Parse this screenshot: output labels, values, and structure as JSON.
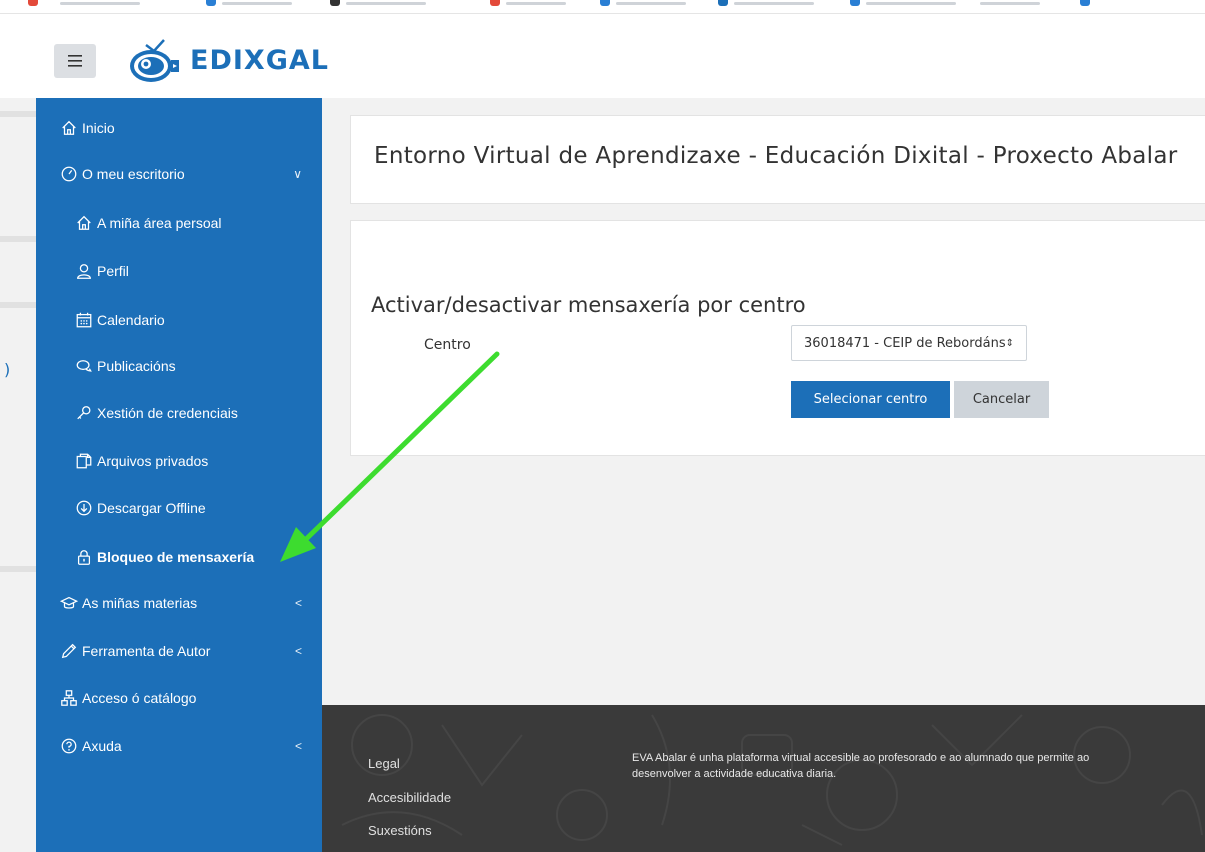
{
  "brand": {
    "name": "EDIXGAL",
    "menu_icon": "hamburger-icon"
  },
  "sidebar": {
    "items": [
      {
        "label": "Inicio",
        "icon": "home-icon"
      },
      {
        "label": "O meu escritorio",
        "icon": "dashboard-gauge-icon",
        "chevron": "∨"
      },
      {
        "label": "A miña área persoal",
        "icon": "home-icon"
      },
      {
        "label": "Perfil",
        "icon": "user-icon"
      },
      {
        "label": "Calendario",
        "icon": "calendar-icon"
      },
      {
        "label": "Publicacións",
        "icon": "chat-bubbles-icon"
      },
      {
        "label": "Xestión de credenciais",
        "icon": "key-icon"
      },
      {
        "label": "Arquivos privados",
        "icon": "files-icon"
      },
      {
        "label": "Descargar Offline",
        "icon": "download-circle-icon"
      },
      {
        "label": "Bloqueo de mensaxería",
        "icon": "lock-icon",
        "active": true
      },
      {
        "label": "As miñas materias",
        "icon": "graduation-cap-icon",
        "chevron": "<"
      },
      {
        "label": "Ferramenta de Autor",
        "icon": "pencil-icon",
        "chevron": "<"
      },
      {
        "label": "Acceso ó catálogo",
        "icon": "sitemap-icon"
      },
      {
        "label": "Axuda",
        "icon": "help-circle-icon",
        "chevron": "<"
      }
    ]
  },
  "header": {
    "title": "Entorno Virtual de Aprendizaxe - Educación Dixital - Proxecto Abalar"
  },
  "form": {
    "heading": "Activar/desactivar mensaxería por centro",
    "centro_label": "Centro",
    "centro_value": "36018471 - CEIP de Rebordáns",
    "submit_label": "Selecionar centro",
    "cancel_label": "Cancelar"
  },
  "footer": {
    "links": [
      "Legal",
      "Accesibilidade",
      "Suxestións"
    ],
    "description_line1": "EVA Abalar é unha plataforma virtual accesible ao profesorado e ao alumnado que permite ao",
    "description_line2": "desenvolver a actividade educativa diaria."
  },
  "colors": {
    "primary": "#1c6fb8",
    "footer": "#3a3a3a",
    "annotation_arrow": "#3ddc2f"
  }
}
